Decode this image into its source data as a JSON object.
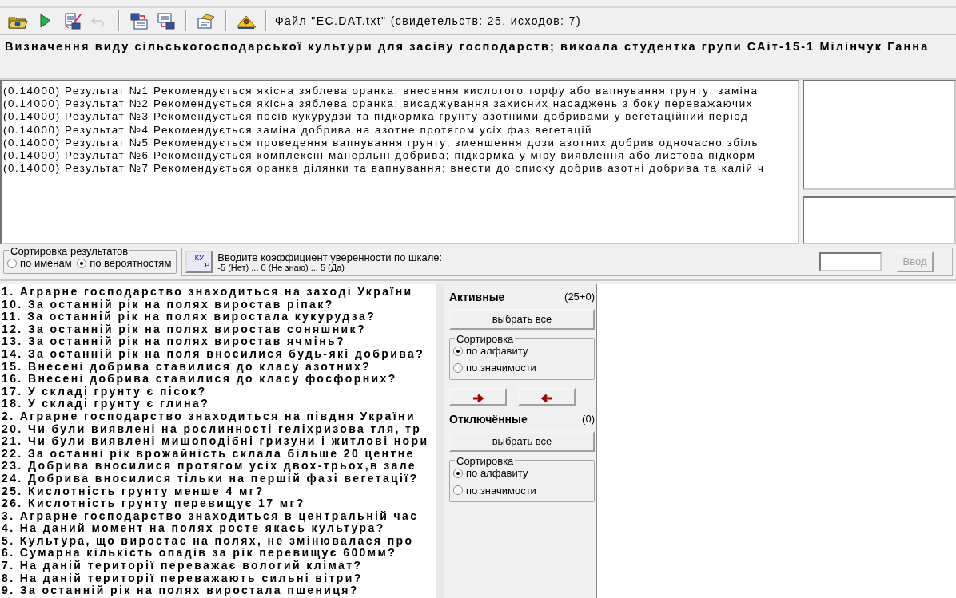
{
  "toolbar": {
    "buttons": [
      {
        "kind": "open",
        "disabled": false
      },
      {
        "kind": "run",
        "disabled": false
      },
      {
        "kind": "edit",
        "disabled": false
      },
      {
        "kind": "undo",
        "disabled": true
      },
      {
        "kind": "separator"
      },
      {
        "kind": "export",
        "disabled": false
      },
      {
        "kind": "import",
        "disabled": false
      },
      {
        "kind": "separator"
      },
      {
        "kind": "settings",
        "disabled": false
      },
      {
        "kind": "separator"
      },
      {
        "kind": "help",
        "disabled": false
      },
      {
        "kind": "separator"
      }
    ],
    "file_label": "Файл  \"EC.DAT.txt\"  (свидетельств: 25, исходов: 7)"
  },
  "title": "Визначення виду сільськогосподарської культури для засіву господарств; викоала студентка групи САіт-15-1 Мілінчук Ганна",
  "results": [
    "(0.14000)  Результат №1 Рекомендується якісна зяблева оранка; внесення кислотого торфу або вапнування грунту; заміна",
    "(0.14000)  Результат №2 Рекомендується якісна зяблева оранка; висаджування захисних насаджень з боку переважаючих",
    "(0.14000)  Результат №3 Рекомендується посів кукурудзи та підкормка грунту азотними добривами у вегетаційний період",
    "(0.14000)  Результат №4 Рекомендується заміна добрива на азотне протягом усіх фаз вегетацій",
    "(0.14000)  Результат №5 Рекомендується проведення вапнування грунту; зменшення дози азотних добрив одночасно збіль",
    "(0.14000)  Результат №6 Рекомендується комплексні манерльні добрива; підкормка у міру виявлення або листова підкорм",
    "(0.14000)  Результат №7 Рекомендується оранка ділянки та вапнування; внести до списку добрив азотні добрива та калій ч"
  ],
  "sort_results": {
    "legend": "Сортировка результатов",
    "options": [
      {
        "label": "по именам",
        "selected": false
      },
      {
        "label": "по вероятностям",
        "selected": true
      }
    ]
  },
  "confidence": {
    "icon_top": "КУ",
    "icon_bottom": "Р",
    "prompt": "Вводите коэффициент уверенности по шкале:",
    "scale": "-5 (Нет) ... 0 (Не знаю) ... 5 (Да)",
    "submit": "Ввод",
    "submit_disabled": true
  },
  "questions": [
    "1. Аграрне господарство знаходиться на заході України",
    "10. За останній рік на полях виростав ріпак?",
    "11. За останній рік на полях виростала кукурудза?",
    "12. За останній рік на полях виростав соняшник?",
    "13. За останній рік на полях виростав ячмінь?",
    "14. За останній рік на поля вносилися будь-які добрива?",
    "15. Внесені добрива ставилися до класу азотних?",
    "16. Внесені добрива ставилися до класу фосфорних?",
    "17. У складі грунту є пісок?",
    "18. У складі грунту є глина?",
    "2. Аграрне господарство знаходиться на півдня України",
    "20. Чи були виявлені на рослинності геліхризова тля, тр",
    "21. Чи були виявлені мишоподібні гризуни і житлові нори",
    "22. За останні рік врожайність склала більше 20 центне",
    "23. Добрива вносилися протягом усіх двох-трьох,в зале",
    "24. Добрива вносилися тільки на першій фазі вегетації?",
    "25. Кислотність грунту менше 4 мг?",
    "26. Кислотність грунту перевищує 17 мг?",
    "3. Аграрне господарство знаходиться в центральній час",
    "4. На даний момент на полях росте якась культура?",
    "5. Культура, що виростає на полях, не змінювалася про",
    "6. Сумарна кількість опадів за рік перевищує 600мм?",
    "7. На даній території переважає вологий клімат?",
    "8. На даній території переважають сильні вітри?",
    "9. За останній рік на полях виростала пшениця?"
  ],
  "active": {
    "title": "Активные",
    "count": "(25+0)",
    "select_all": "выбрать все",
    "sort_legend": "Сортировка",
    "options": [
      {
        "label": "по алфавиту",
        "selected": true
      },
      {
        "label": "по значимости",
        "selected": false
      }
    ]
  },
  "excluded": {
    "title": "Отключённые",
    "count": "(0)",
    "select_all": "выбрать все",
    "sort_legend": "Сортировка",
    "options": [
      {
        "label": "по алфавиту",
        "selected": true
      },
      {
        "label": "по значимости",
        "selected": false
      }
    ]
  }
}
